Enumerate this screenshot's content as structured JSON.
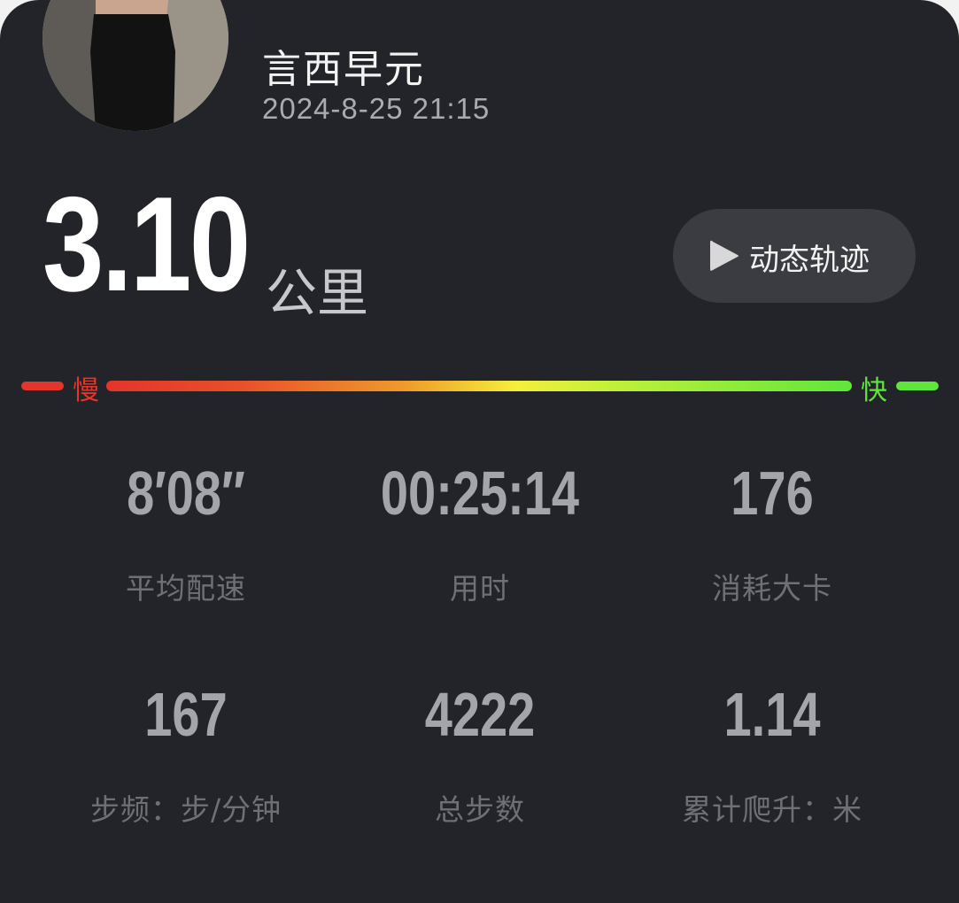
{
  "profile": {
    "name": "言西早元",
    "datetime": "2024-8-25 21:15"
  },
  "distance": {
    "value": "3.10",
    "unit": "公里"
  },
  "track_button": {
    "label": "动态轨迹",
    "icon": "play-icon"
  },
  "pace_scale": {
    "slow_label": "慢",
    "fast_label": "快",
    "colors": {
      "slow": "#e2352b",
      "mid": "#f5ef3a",
      "fast": "#5fe63b"
    }
  },
  "stats": [
    {
      "value": "8′08′′",
      "label": "平均配速"
    },
    {
      "value": "00:25:14",
      "label": "用时"
    },
    {
      "value": "176",
      "label": "消耗大卡"
    },
    {
      "value": "167",
      "label": "步频：步/分钟"
    },
    {
      "value": "4222",
      "label": "总步数"
    },
    {
      "value": "1.14",
      "label": "累计爬升：米"
    }
  ],
  "theme": {
    "background": "#222429",
    "button_background": "#3a3c42",
    "stat_value_color": "#a3a5aa",
    "stat_label_color": "#6e7076"
  }
}
